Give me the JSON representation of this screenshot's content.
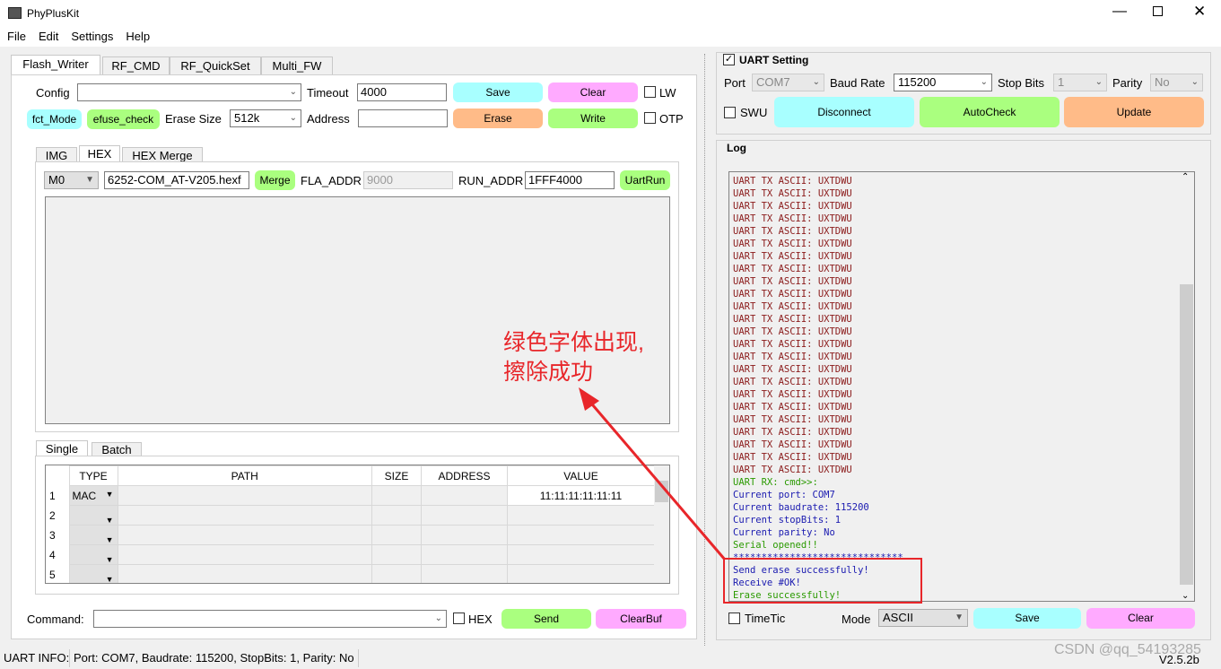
{
  "window": {
    "title": "PhyPlusKit",
    "version": "V2.5.2b"
  },
  "menu": [
    "File",
    "Edit",
    "Settings",
    "Help"
  ],
  "tabs": [
    "Flash_Writer",
    "RF_CMD",
    "RF_QuickSet",
    "Multi_FW"
  ],
  "flash": {
    "config_label": "Config",
    "config_value": "",
    "timeout_label": "Timeout",
    "timeout_value": "4000",
    "save": "Save",
    "clear": "Clear",
    "lw": "LW",
    "fct_mode": "fct_Mode",
    "efuse_check": "efuse_check",
    "erase_size_label": "Erase Size",
    "erase_size_value": "512k",
    "address_label": "Address",
    "address_value": "",
    "erase": "Erase",
    "write": "Write",
    "otp": "OTP"
  },
  "subtabs": [
    "IMG",
    "HEX",
    "HEX Merge"
  ],
  "hex": {
    "mode": "M0",
    "file": "6252-COM_AT-V205.hexf",
    "merge": "Merge",
    "fla_addr_label": "FLA_ADDR",
    "fla_addr_value": "9000",
    "run_addr_label": "RUN_ADDR",
    "run_addr_value": "1FFF4000",
    "uartrun": "UartRun"
  },
  "bottomtabs": [
    "Single",
    "Batch"
  ],
  "table": {
    "headers": [
      "TYPE",
      "PATH",
      "SIZE",
      "ADDRESS",
      "VALUE"
    ],
    "rows": [
      {
        "n": "1",
        "type": "MAC",
        "value": "11:11:11:11:11:11"
      },
      {
        "n": "2",
        "type": "",
        "value": ""
      },
      {
        "n": "3",
        "type": "",
        "value": ""
      },
      {
        "n": "4",
        "type": "",
        "value": ""
      },
      {
        "n": "5",
        "type": "",
        "value": ""
      }
    ]
  },
  "command": {
    "label": "Command:",
    "value": "",
    "hex": "HEX",
    "send": "Send",
    "clearbuf": "ClearBuf"
  },
  "status": {
    "label": "UART INFO:",
    "text": "Port: COM7, Baudrate: 115200, StopBits: 1, Parity: No"
  },
  "uart": {
    "title": "UART Setting",
    "checked": true,
    "port_label": "Port",
    "port_value": "COM7",
    "baud_label": "Baud Rate",
    "baud_value": "115200",
    "stop_label": "Stop Bits",
    "stop_value": "1",
    "parity_label": "Parity",
    "parity_value": "No",
    "swu": "SWU",
    "disconnect": "Disconnect",
    "autocheck": "AutoCheck",
    "update": "Update"
  },
  "log": {
    "title": "Log",
    "lines": [
      {
        "t": "UART TX ASCII: UXTDWU",
        "c": "red"
      },
      {
        "t": "UART TX ASCII: UXTDWU",
        "c": "red"
      },
      {
        "t": "UART TX ASCII: UXTDWU",
        "c": "red"
      },
      {
        "t": "UART TX ASCII: UXTDWU",
        "c": "red"
      },
      {
        "t": "UART TX ASCII: UXTDWU",
        "c": "red"
      },
      {
        "t": "UART TX ASCII: UXTDWU",
        "c": "red"
      },
      {
        "t": "UART TX ASCII: UXTDWU",
        "c": "red"
      },
      {
        "t": "UART TX ASCII: UXTDWU",
        "c": "red"
      },
      {
        "t": "UART TX ASCII: UXTDWU",
        "c": "red"
      },
      {
        "t": "UART TX ASCII: UXTDWU",
        "c": "red"
      },
      {
        "t": "UART TX ASCII: UXTDWU",
        "c": "red"
      },
      {
        "t": "UART TX ASCII: UXTDWU",
        "c": "red"
      },
      {
        "t": "UART TX ASCII: UXTDWU",
        "c": "red"
      },
      {
        "t": "UART TX ASCII: UXTDWU",
        "c": "red"
      },
      {
        "t": "UART TX ASCII: UXTDWU",
        "c": "red"
      },
      {
        "t": "UART TX ASCII: UXTDWU",
        "c": "red"
      },
      {
        "t": "UART TX ASCII: UXTDWU",
        "c": "red"
      },
      {
        "t": "UART TX ASCII: UXTDWU",
        "c": "red"
      },
      {
        "t": "UART TX ASCII: UXTDWU",
        "c": "red"
      },
      {
        "t": "UART TX ASCII: UXTDWU",
        "c": "red"
      },
      {
        "t": "UART TX ASCII: UXTDWU",
        "c": "red"
      },
      {
        "t": "UART TX ASCII: UXTDWU",
        "c": "red"
      },
      {
        "t": "UART TX ASCII: UXTDWU",
        "c": "red"
      },
      {
        "t": "UART TX ASCII: UXTDWU",
        "c": "red"
      },
      {
        "t": "UART RX: cmd>>:",
        "c": "green"
      },
      {
        "t": "Current port: COM7",
        "c": "blue"
      },
      {
        "t": "Current baudrate: 115200",
        "c": "blue"
      },
      {
        "t": "Current stopBits: 1",
        "c": "blue"
      },
      {
        "t": "Current parity: No",
        "c": "blue"
      },
      {
        "t": "Serial opened!!",
        "c": "green"
      },
      {
        "t": "******************************",
        "c": "blue"
      },
      {
        "t": "Send erase successfully!",
        "c": "blue"
      },
      {
        "t": "Receive #OK!",
        "c": "blue"
      },
      {
        "t": "Erase successfully!",
        "c": "green"
      }
    ],
    "timetic": "TimeTic",
    "mode_label": "Mode",
    "mode_value": "ASCII",
    "save": "Save",
    "clear": "Clear"
  },
  "annotation": {
    "line1": "绿色字体出现,",
    "line2": "擦除成功",
    "color": "#e8262a"
  },
  "watermark": "CSDN @qq_54193285"
}
